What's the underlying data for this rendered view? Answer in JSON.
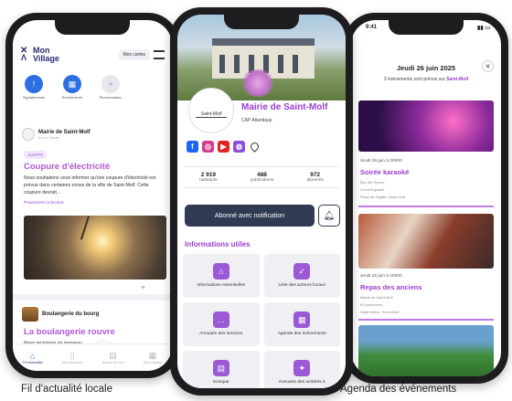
{
  "left_phone": {
    "logo_line1": "Mon",
    "logo_line2": "Village",
    "cards_button": "Mes cartes",
    "shortcuts": [
      {
        "icon": "warning-icon",
        "label": "Signalements"
      },
      {
        "icon": "calendar-icon",
        "label": "Événements"
      },
      {
        "icon": "plus-icon",
        "label": "Personnaliser"
      }
    ],
    "post1": {
      "author": "Mairie de Saint-Molf",
      "meta": "Il y a 1 heure",
      "badge": "ALERTE",
      "title": "Coupure d'électricité",
      "body": "Nous souhaitons vous informer qu'une coupure d'électricité est prévue dans certaines zones de la ville de Saint-Molf. Cette coupure devrait...",
      "read_more": "Poursuivre la lecture"
    },
    "post2": {
      "author": "Boulangerie du bourg",
      "title": "La boulangerie rouvre",
      "body": "Nous recrutons un nouveau"
    },
    "tabs": [
      {
        "icon": "home-icon",
        "label": "Fil d'actualité"
      },
      {
        "icon": "bookmark-icon",
        "label": "Mes abonnés"
      },
      {
        "icon": "map-icon",
        "label": "Autour de moi"
      },
      {
        "icon": "grid-icon",
        "label": "Mon espace"
      }
    ]
  },
  "mid_phone": {
    "name": "Mairie de Saint-Molf",
    "subtitle": "CAP Atlantique",
    "crest_text": "Saint-Molf",
    "stats": [
      {
        "value": "2 919",
        "label": "habitants"
      },
      {
        "value": "488",
        "label": "publications"
      },
      {
        "value": "972",
        "label": "abonnés"
      }
    ],
    "notify_button": "Abonné avec notification",
    "section_title": "Informations utiles",
    "tiles": [
      {
        "icon": "house-icon",
        "label": "Informations essentielles"
      },
      {
        "icon": "thumbs-up-icon",
        "label": "Liste des acteurs locaux"
      },
      {
        "icon": "chat-icon",
        "label": "Annuaire des services"
      },
      {
        "icon": "calendar-icon",
        "label": "Agenda des événements"
      },
      {
        "icon": "kiosk-icon",
        "label": "Kiosque"
      },
      {
        "icon": "runner-icon",
        "label": "Annuaire des activités à"
      }
    ]
  },
  "right_phone": {
    "time": "9:41",
    "date": "Jeudi 26 juin 2025",
    "count_text": "3 événements sont prévus sur",
    "count_place": "Saint-Molf",
    "events": [
      {
        "when": "Jeudi 26 juin à 20h00",
        "title": "Soirée karaoké",
        "line1": "Bar des Sports",
        "line2": "Concert gratuit",
        "line3": "Place de l'église, Saint-Molf"
      },
      {
        "when": "Jeudi 26 juin à 20h00",
        "title": "Repas des anciens",
        "line1": "Mairie de Saint-Molf",
        "line2": "60 personnes",
        "line3": "Salle festive, Saint-Molf"
      },
      {
        "when": "",
        "title": "",
        "line1": "",
        "line2": "",
        "line3": ""
      }
    ]
  },
  "captions": {
    "left": "Fil d'actualité locale",
    "right": "Agenda des événements"
  }
}
